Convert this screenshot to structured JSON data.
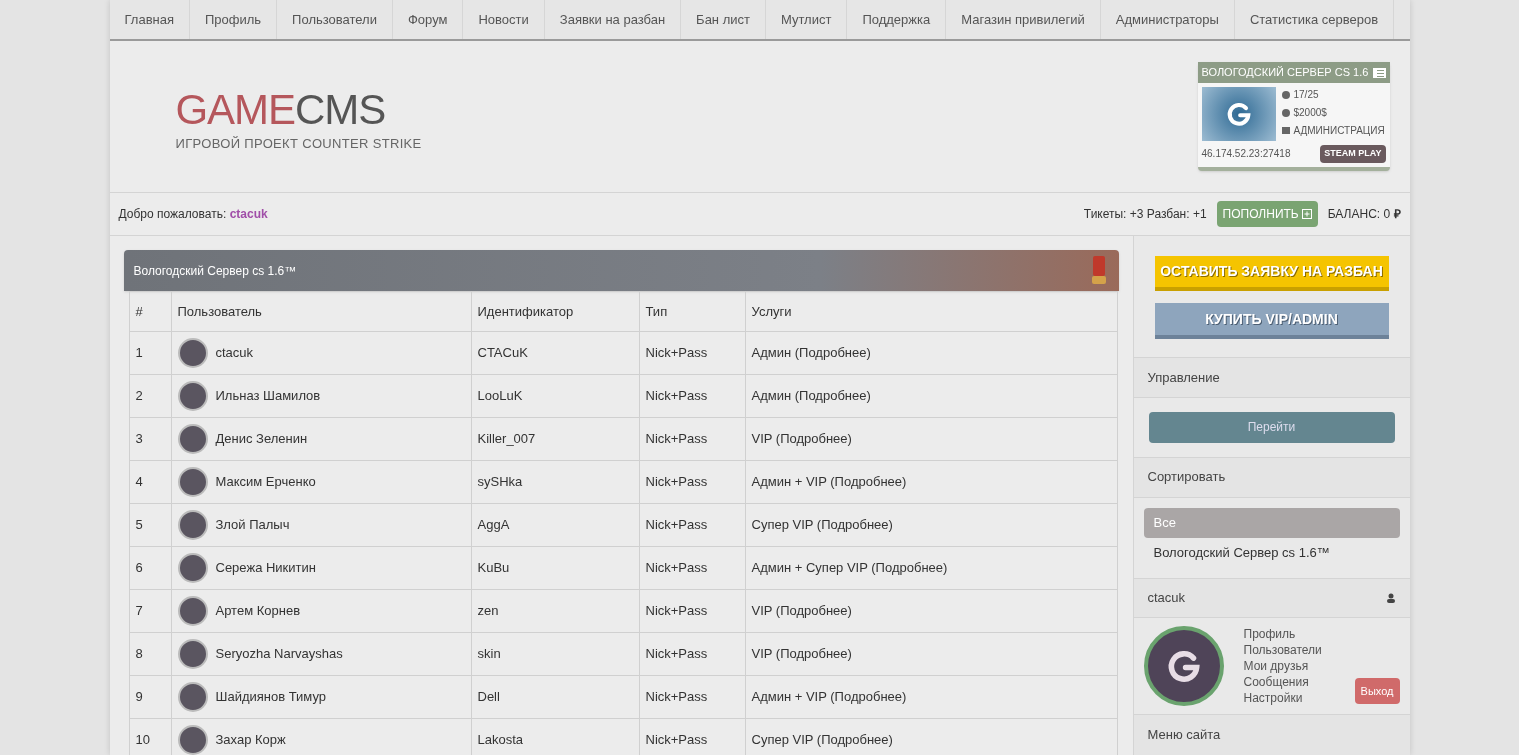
{
  "nav": [
    "Главная",
    "Профиль",
    "Пользователи",
    "Форум",
    "Новости",
    "Заявки на разбан",
    "Бан лист",
    "Мутлист",
    "Поддержка",
    "Магазин привилегий",
    "Администраторы",
    "Статистика серверов"
  ],
  "logo": {
    "part1": "GAME",
    "part2": "CMS",
    "tagline": "ИГРОВОЙ ПРОЕКТ COUNTER STRIKE"
  },
  "server_card": {
    "title": "ВОЛОГОДСКИЙ СЕРВЕР CS 1.6",
    "players": "17/25",
    "map": "$2000$",
    "mode": "АДМИНИСТРАЦИЯ",
    "address": "46.174.52.23:27418",
    "play_button": "STEAM PLAY"
  },
  "welcome": {
    "label": "Добро пожаловать:",
    "user": "ctacuk"
  },
  "stats": {
    "text": "Тикеты: +3 Разбан: +1",
    "topup_button": "ПОПОЛНИТЬ",
    "balance": "БАЛАНС: 0",
    "currency": "₽"
  },
  "panel_title": "Вологодский Сервер cs 1.6™",
  "table": {
    "columns": [
      "#",
      "Пользователь",
      "Идентификатор",
      "Тип",
      "Услуги"
    ],
    "rows": [
      {
        "n": "1",
        "user": "ctacuk",
        "id": "CTACuK",
        "type": "Nick+Pass",
        "services": "Админ (Подробнее)"
      },
      {
        "n": "2",
        "user": "Ильназ Шамилов",
        "id": "LooLuK",
        "type": "Nick+Pass",
        "services": "Админ (Подробнее)"
      },
      {
        "n": "3",
        "user": "Денис Зеленин",
        "id": "Killer_007",
        "type": "Nick+Pass",
        "services": "VIP (Подробнее)"
      },
      {
        "n": "4",
        "user": "Максим Ерченко",
        "id": "sySHka",
        "type": "Nick+Pass",
        "services": "Админ + VIP (Подробнее)"
      },
      {
        "n": "5",
        "user": "Злой Палыч",
        "id": "AggA",
        "type": "Nick+Pass",
        "services": "Супер VIP (Подробнее)"
      },
      {
        "n": "6",
        "user": "Сережа Никитин",
        "id": "KuBu",
        "type": "Nick+Pass",
        "services": "Админ + Супер VIP (Подробнее)"
      },
      {
        "n": "7",
        "user": "Артем Корнев",
        "id": "zen",
        "type": "Nick+Pass",
        "services": "VIP (Подробнее)"
      },
      {
        "n": "8",
        "user": "Seryozha Narvayshas",
        "id": "skin",
        "type": "Nick+Pass",
        "services": "VIP (Подробнее)"
      },
      {
        "n": "9",
        "user": "Шайдиянов Тимур",
        "id": "Dell",
        "type": "Nick+Pass",
        "services": "Админ + VIP (Подробнее)"
      },
      {
        "n": "10",
        "user": "Захар Корж",
        "id": "Lakosta",
        "type": "Nick+Pass",
        "services": "Супер VIP (Подробнее)"
      }
    ]
  },
  "sidebar": {
    "unban_button": "ОСТАВИТЬ ЗАЯВКУ НА РАЗБАН",
    "buy_button": "КУПИТЬ VIP/ADMIN",
    "manage_title": "Управление",
    "go_button": "Перейти",
    "sort_title": "Сортировать",
    "sort_items": [
      {
        "label": "Все",
        "selected": true
      },
      {
        "label": "Вологодский Сервер cs 1.6™",
        "selected": false
      }
    ],
    "user_title": "ctacuk",
    "user_links": [
      "Профиль",
      "Пользователи",
      "Мои друзья",
      "Сообщения",
      "Настройки"
    ],
    "logout_button": "Выход",
    "menu_title": "Меню сайта"
  }
}
